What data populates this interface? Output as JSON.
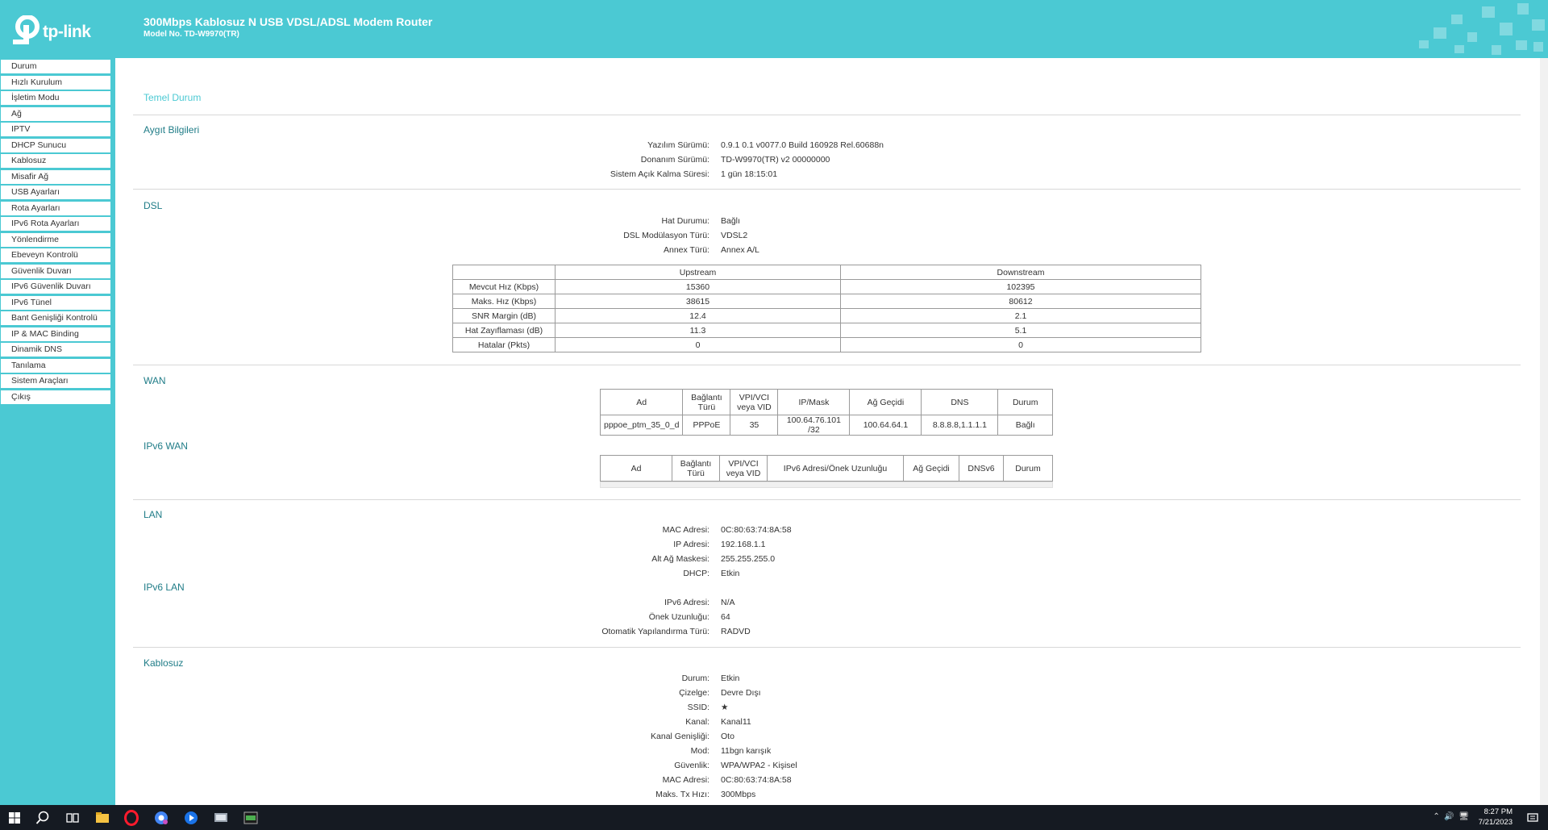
{
  "header": {
    "logo_text": "tp-link",
    "title": "300Mbps Kablosuz N USB VDSL/ADSL Modem Router",
    "model": "Model No. TD-W9970(TR)",
    "brand_color": "#4bc9d3"
  },
  "sidebar": {
    "items": [
      {
        "label": "Durum"
      },
      {
        "label": "Hızlı Kurulum"
      },
      {
        "label": "İşletim Modu"
      },
      {
        "label": "Ağ"
      },
      {
        "label": "IPTV"
      },
      {
        "label": "DHCP Sunucu"
      },
      {
        "label": "Kablosuz"
      },
      {
        "label": "Misafir Ağ"
      },
      {
        "label": "USB Ayarları"
      },
      {
        "label": "Rota Ayarları"
      },
      {
        "label": "IPv6 Rota Ayarları"
      },
      {
        "label": "Yönlendirme"
      },
      {
        "label": "Ebeveyn Kontrolü"
      },
      {
        "label": "Güvenlik Duvarı"
      },
      {
        "label": "IPv6 Güvenlik Duvarı"
      },
      {
        "label": "IPv6 Tünel"
      },
      {
        "label": "Bant Genişliği Kontrolü"
      },
      {
        "label": "IP & MAC Binding"
      },
      {
        "label": "Dinamik DNS"
      },
      {
        "label": "Tanılama"
      },
      {
        "label": "Sistem Araçları"
      },
      {
        "label": "Çıkış"
      }
    ]
  },
  "main": {
    "page_title": "Temel Durum",
    "device": {
      "title": "Aygıt Bilgileri",
      "rows": [
        {
          "label": "Yazılım Sürümü:",
          "value": "0.9.1 0.1 v0077.0 Build 160928 Rel.60688n"
        },
        {
          "label": "Donanım Sürümü:",
          "value": "TD-W9970(TR) v2 00000000"
        },
        {
          "label": "Sistem Açık Kalma Süresi:",
          "value": "1 gün 18:15:01"
        }
      ]
    },
    "dsl": {
      "title": "DSL",
      "rows": [
        {
          "label": "Hat Durumu:",
          "value": "Bağlı"
        },
        {
          "label": "DSL Modülasyon Türü:",
          "value": "VDSL2"
        },
        {
          "label": "Annex Türü:",
          "value": "Annex A/L"
        }
      ],
      "table": {
        "headers": [
          "",
          "Upstream",
          "Downstream"
        ],
        "rows": [
          [
            "Mevcut Hız (Kbps)",
            "15360",
            "102395"
          ],
          [
            "Maks. Hız (Kbps)",
            "38615",
            "80612"
          ],
          [
            "SNR Margin (dB)",
            "12.4",
            "2.1"
          ],
          [
            "Hat Zayıflaması (dB)",
            "11.3",
            "5.1"
          ],
          [
            "Hatalar (Pkts)",
            "0",
            "0"
          ]
        ]
      }
    },
    "wan": {
      "title": "WAN",
      "headers": [
        "Ad",
        "Bağlantı Türü",
        "VPI/VCI veya VID",
        "IP/Mask",
        "Ağ Geçidi",
        "DNS",
        "Durum"
      ],
      "rows": [
        [
          "pppoe_ptm_35_0_d",
          "PPPoE",
          "35",
          "100.64.76.101 /32",
          "100.64.64.1",
          "8.8.8.8,1.1.1.1",
          "Bağlı"
        ]
      ]
    },
    "ipv6_wan": {
      "title": "IPv6 WAN",
      "headers": [
        "Ad",
        "Bağlantı Türü",
        "VPI/VCI veya VID",
        "IPv6 Adresi/Önek Uzunluğu",
        "Ağ Geçidi",
        "DNSv6",
        "Durum"
      ]
    },
    "lan": {
      "title": "LAN",
      "rows": [
        {
          "label": "MAC Adresi:",
          "value": "0C:80:63:74:8A:58"
        },
        {
          "label": "IP Adresi:",
          "value": "192.168.1.1"
        },
        {
          "label": "Alt Ağ Maskesi:",
          "value": "255.255.255.0"
        },
        {
          "label": "DHCP:",
          "value": "Etkin"
        }
      ]
    },
    "ipv6_lan": {
      "title": "IPv6 LAN",
      "rows": [
        {
          "label": "IPv6 Adresi:",
          "value": "N/A"
        },
        {
          "label": "Önek Uzunluğu:",
          "value": "64"
        },
        {
          "label": "Otomatik Yapılandırma Türü:",
          "value": "RADVD"
        }
      ]
    },
    "wireless": {
      "title": "Kablosuz",
      "rows": [
        {
          "label": "Durum:",
          "value": "Etkin"
        },
        {
          "label": "Çizelge:",
          "value": "Devre Dışı"
        },
        {
          "label": "SSID:",
          "value": "★"
        },
        {
          "label": "Kanal:",
          "value": "Kanal11"
        },
        {
          "label": "Kanal Genişliği:",
          "value": "Oto"
        },
        {
          "label": "Mod:",
          "value": "11bgn karışık"
        },
        {
          "label": "Güvenlik:",
          "value": "WPA/WPA2 - Kişisel"
        },
        {
          "label": "MAC Adresi:",
          "value": "0C:80:63:74:8A:58"
        },
        {
          "label": "Maks. Tx Hızı:",
          "value": "300Mbps"
        }
      ]
    }
  },
  "taskbar": {
    "time": "8:27 PM",
    "date": "7/21/2023",
    "icons": [
      "windows-start-icon",
      "search-icon",
      "task-view-icon",
      "file-explorer-icon",
      "opera-icon",
      "chrome-icon",
      "media-icon",
      "app-icon",
      "terminal-icon"
    ]
  }
}
